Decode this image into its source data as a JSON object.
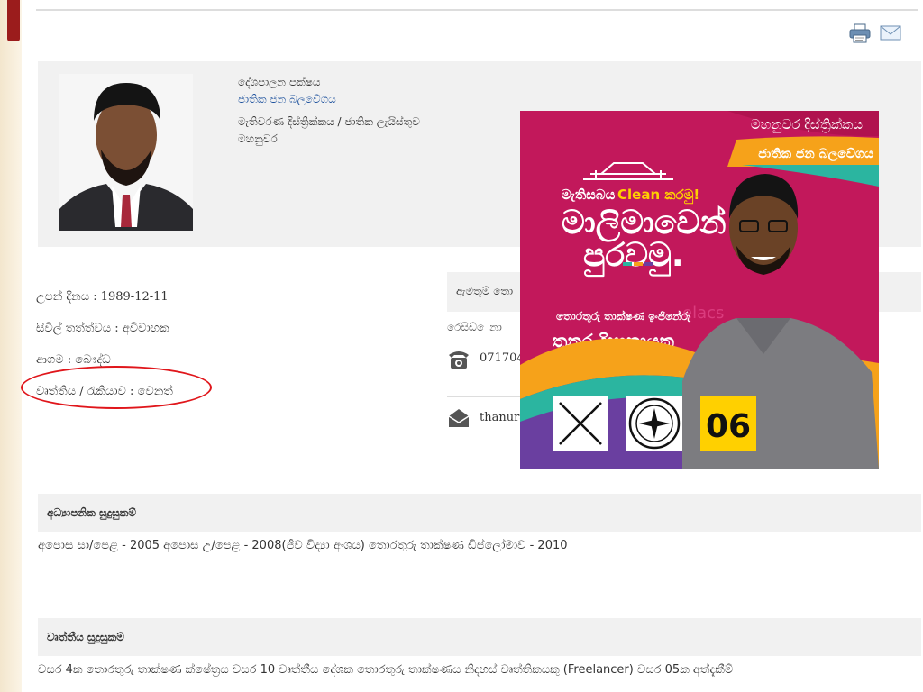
{
  "toolbar": {
    "print_icon": "printer-icon",
    "email_icon": "envelope-icon"
  },
  "profile": {
    "party_label": "දේශපාලන පක්ෂය",
    "party_name": "ජාතික ජන බලවේගය",
    "district_label": "මැතිවරණ දිස්ත්‍රික්කය / ජාතික ලැයිස්තුව",
    "district_name": "මහනුවර"
  },
  "details": {
    "dob": "උපන් දිනය : 1989-12-11",
    "civil_status": "සිවිල් තත්ත්වය : අවිවාහක",
    "religion": "ආගම : බෞද්ධ",
    "occupation": "වෘත්තිය / රැකියාව : වෙනත්"
  },
  "contact": {
    "header": "ඇමතුම් තො",
    "residence_label": "රෙසිඩ් ෙනා",
    "phone": "071704",
    "email": "thanura"
  },
  "poster": {
    "district": "මහනුවර දිස්ත්‍රික්කය",
    "party": "ජාතික ජන බලවේගය",
    "slogan_top": "මැතිසබය",
    "slogan_clean": "Clean කරමු!",
    "slogan_main1": "මාලිමාවෙන්",
    "slogan_main2": "පුරවමු.",
    "role": "තොරතුරු තාක්ෂණ ඉංජිනේරු",
    "name": "තනුර දිසානායක",
    "number": "06",
    "watermark": "elacs"
  },
  "education": {
    "header": "අධ්‍යාපනික සුදුසුකම්",
    "text": "අපොස සා/පෙළ - 2005 අපොස උ/පෙළ - 2008(ජීව විද්‍යා අංශය) තොරතුරු තාක්ෂණ ඩිප්ලෝමාව - 2010"
  },
  "profession": {
    "header": "වෘත්තීය සුදුසුකම්",
    "text": "වසර 4ක තොරතුරු තාක්ෂණ ක්ෂේත්‍රය වසර 10 වෘත්තීය දේශක තොරතුරු තාක්ෂණය නිදහස් වෘත්තිකයකු (Freelancer) වසර 05ක අත්දැකීම්"
  },
  "colors": {
    "accent_red": "#e0161b",
    "link_blue": "#1a4f9c",
    "poster_magenta": "#c2185b",
    "poster_yellow": "#ffd000"
  }
}
